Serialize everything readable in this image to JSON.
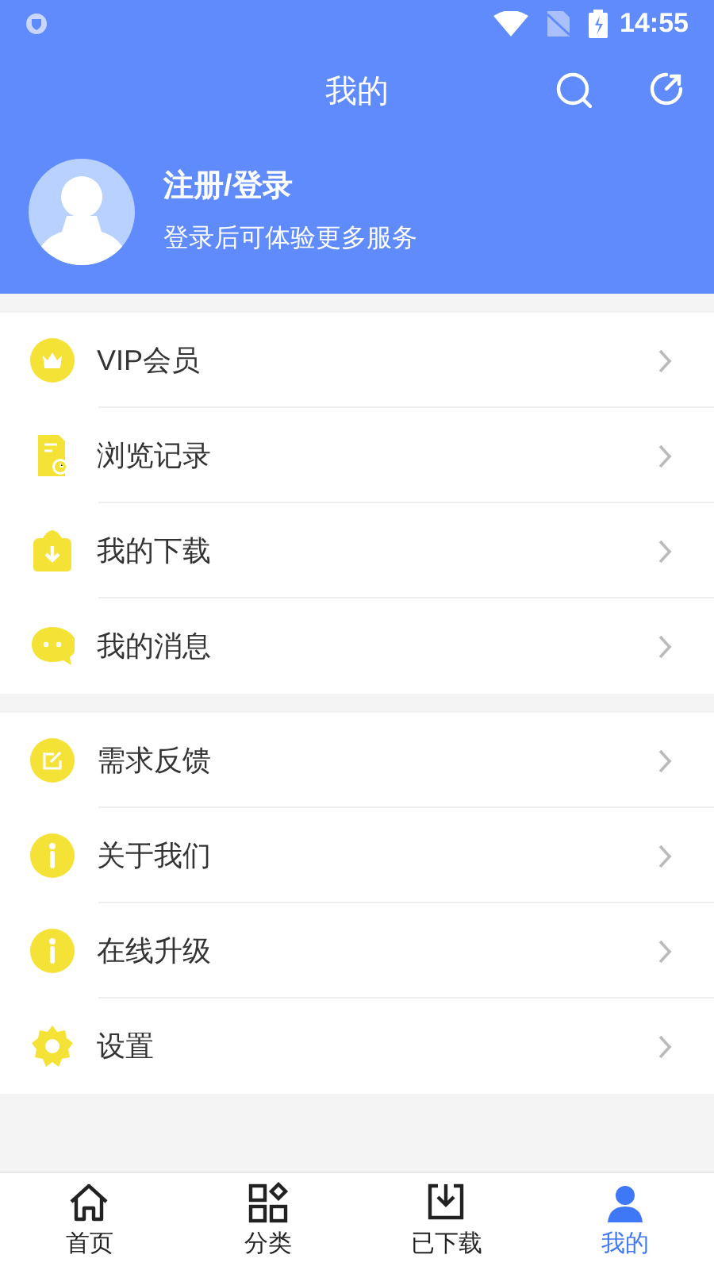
{
  "status_bar": {
    "time": "14:55"
  },
  "header": {
    "title": "我的"
  },
  "profile": {
    "name": "注册/登录",
    "subtitle": "登录后可体验更多服务"
  },
  "menu_groups": [
    {
      "items": [
        {
          "label": "VIP会员"
        },
        {
          "label": "浏览记录"
        },
        {
          "label": "我的下载"
        },
        {
          "label": "我的消息"
        }
      ]
    },
    {
      "items": [
        {
          "label": "需求反馈"
        },
        {
          "label": "关于我们"
        },
        {
          "label": "在线升级"
        },
        {
          "label": "设置"
        }
      ]
    }
  ],
  "bottom_nav": [
    {
      "label": "首页",
      "selected": false
    },
    {
      "label": "分类",
      "selected": false
    },
    {
      "label": "已下载",
      "selected": false
    },
    {
      "label": "我的",
      "selected": true
    }
  ]
}
